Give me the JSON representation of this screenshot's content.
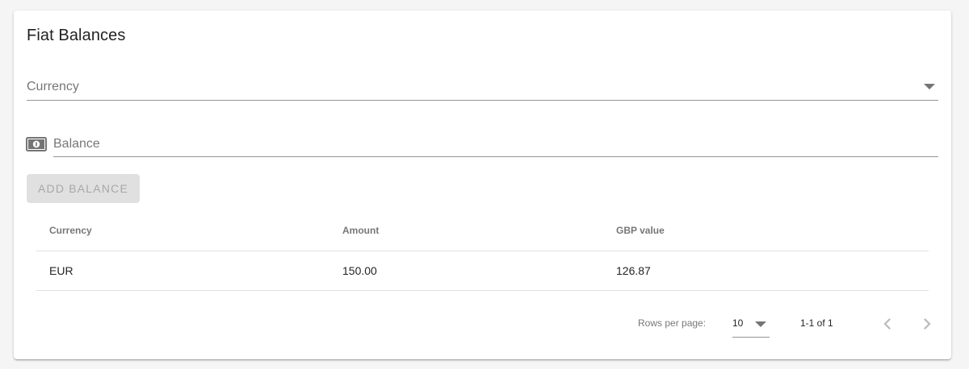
{
  "card": {
    "title": "Fiat Balances"
  },
  "currency_select": {
    "label": "Currency"
  },
  "balance_input": {
    "placeholder": "Balance",
    "value": ""
  },
  "add_button": {
    "label": "ADD BALANCE"
  },
  "table": {
    "headers": [
      "Currency",
      "Amount",
      "GBP value"
    ],
    "rows": [
      [
        "EUR",
        "150.00",
        "126.87"
      ]
    ]
  },
  "pagination": {
    "rows_per_page_label": "Rows per page:",
    "rows_per_page_value": "10",
    "range": "1-1 of 1"
  },
  "icons": {
    "money": "money-icon",
    "prev": "chevron-left-icon",
    "next": "chevron-right-icon",
    "dropdown": "arrow-drop-down-icon"
  },
  "colors": {
    "disabled_button_bg": "#e0e0e0",
    "disabled_button_text": "#bdbdbd",
    "divider": "#e0e0e0"
  }
}
